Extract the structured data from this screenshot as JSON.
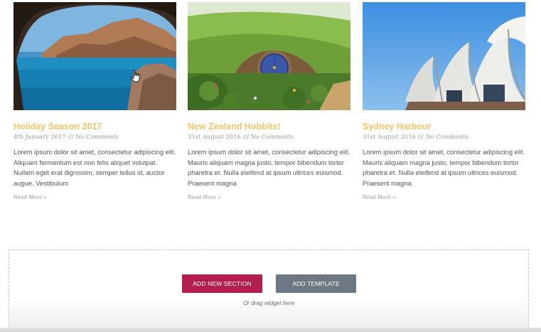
{
  "posts": [
    {
      "title": "Holiday Season 2017",
      "meta": "4th January 2017 /// No Comments",
      "excerpt": "Lorem ipsum dolor sit amet, consectetur adipiscing elit. Aliquam fermentum est non felis aliquet volutpat. Nullam eget erat dignissim, semper tellus id, auctor augue. Vestibulum",
      "read_more": "Read More »"
    },
    {
      "title": "New Zealand Hobbits!",
      "meta": "31st August 2016 /// No Comments",
      "excerpt": "Lorem ipsum dolor sit amet, consectetur adipiscing elit. Mauris aliquam magna justo, tempor bibendum tortor pharetra et. Nulla eleifend at ipsum ultrices euismod. Praesent magna",
      "read_more": "Read More »"
    },
    {
      "title": "Sydney Harbour",
      "meta": "31st August 2016 /// No Comments",
      "excerpt": "Lorem ipsum dolor sit amet, consectetur adipiscing elit. Mauris aliquam magna justo, tempor bibendum tortor pharetra et. Nulla eleifend at ipsum ultrices euismod. Praesent magna",
      "read_more": "Read More »"
    }
  ],
  "editor": {
    "add_section_label": "ADD NEW SECTION",
    "add_template_label": "ADD TEMPLATE",
    "drag_hint": "Or drag widget here"
  },
  "colors": {
    "post_title": "#f5c469",
    "add_section_button": "#b31e4e",
    "add_template_button": "#6d7882"
  },
  "icons": {
    "cursor": "hand-pointer-icon"
  }
}
